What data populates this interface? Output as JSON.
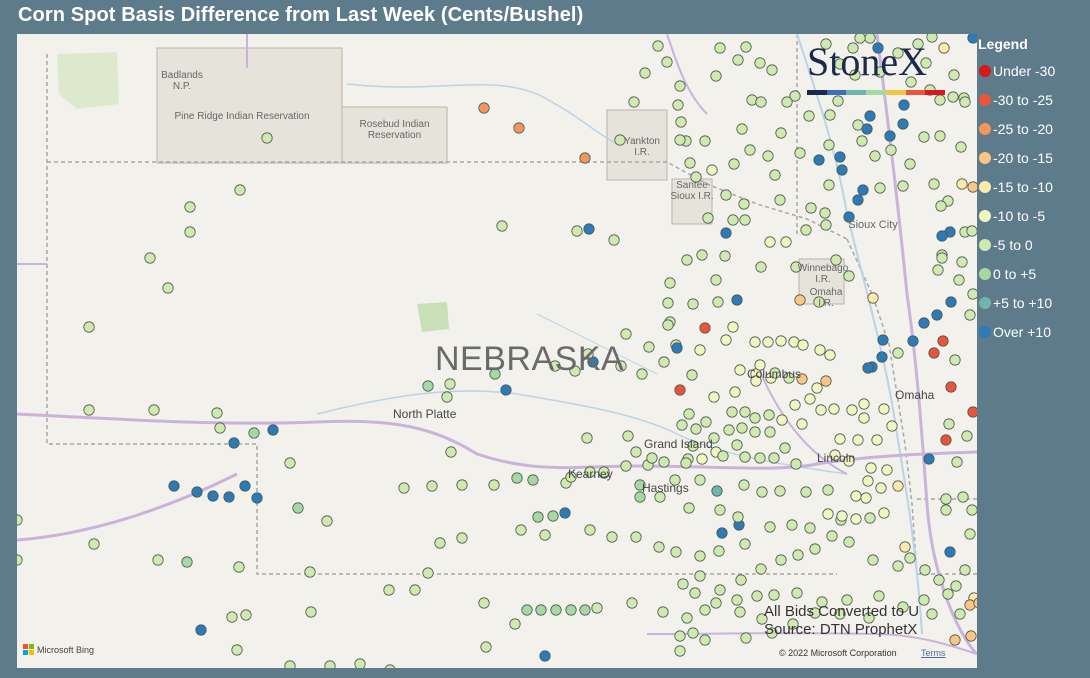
{
  "title": "Corn Spot Basis Difference from Last Week (Cents/Bushel)",
  "legend": {
    "title": "Legend",
    "items": [
      {
        "label": "Under -30",
        "color": "#d7191c"
      },
      {
        "label": "-30 to -25",
        "color": "#e8553a"
      },
      {
        "label": "-25 to -20",
        "color": "#f4955c"
      },
      {
        "label": "-20 to -15",
        "color": "#fbc583"
      },
      {
        "label": "-15 to -10",
        "color": "#fde9ab"
      },
      {
        "label": "-10 to -5",
        "color": "#f1f6c0"
      },
      {
        "label": "-5 to 0",
        "color": "#cfe9ae"
      },
      {
        "label": "0 to +5",
        "color": "#a6d9a2"
      },
      {
        "label": "+5 to +10",
        "color": "#6fb5ae"
      },
      {
        "label": "Over +10",
        "color": "#2c7bb6"
      }
    ]
  },
  "map": {
    "state_label": "NEBRASKA",
    "places": [
      "Badlands N.P.",
      "Pine Ridge Indian Reservation",
      "Rosebud Indian Reservation",
      "Yankton I.R.",
      "Santee Sioux I.R.",
      "Sioux City",
      "Winnebago I.R.",
      "Omaha I.R.",
      "Columbus",
      "Omaha",
      "North Platte",
      "Grand Island",
      "Kearney",
      "Hastings",
      "Lincoln"
    ],
    "attribution": {
      "provider": "Microsoft Bing",
      "copyright": "© 2022 Microsoft Corporation",
      "terms": "Terms"
    }
  },
  "logo": {
    "text": "StoneX",
    "colors": [
      "#1b2a4a",
      "#3b6fb6",
      "#6fb5ae",
      "#a6d9a2",
      "#f4c542",
      "#e8553a",
      "#d7191c"
    ]
  },
  "notes": {
    "line1": "All Bids Converted to U",
    "line2": "Source: DTN ProphetX"
  },
  "points": [
    [
      267,
      138,
      6
    ],
    [
      240,
      190,
      6
    ],
    [
      190,
      207,
      6
    ],
    [
      190,
      232,
      6
    ],
    [
      150,
      258,
      6
    ],
    [
      168,
      288,
      6
    ],
    [
      89,
      327,
      6
    ],
    [
      484,
      108,
      2
    ],
    [
      519,
      128,
      2
    ],
    [
      585,
      158,
      2
    ],
    [
      620,
      140,
      6
    ],
    [
      502,
      226,
      6
    ],
    [
      577,
      231,
      6
    ],
    [
      589,
      229,
      9
    ],
    [
      614,
      240,
      6
    ],
    [
      89,
      410,
      6
    ],
    [
      154,
      410,
      6
    ],
    [
      217,
      413,
      6
    ],
    [
      220,
      428,
      6
    ],
    [
      234,
      443,
      9
    ],
    [
      254,
      433,
      7
    ],
    [
      273,
      430,
      9
    ],
    [
      290,
      463,
      6
    ],
    [
      174,
      486,
      9
    ],
    [
      197,
      492,
      9
    ],
    [
      213,
      496,
      9
    ],
    [
      229,
      497,
      9
    ],
    [
      245,
      486,
      9
    ],
    [
      257,
      498,
      9
    ],
    [
      298,
      508,
      7
    ],
    [
      327,
      521,
      6
    ],
    [
      404,
      488,
      6
    ],
    [
      432,
      486,
      6
    ],
    [
      462,
      485,
      6
    ],
    [
      494,
      485,
      6
    ],
    [
      517,
      478,
      7
    ],
    [
      533,
      480,
      7
    ],
    [
      566,
      483,
      6
    ],
    [
      571,
      477,
      6
    ],
    [
      590,
      472,
      6
    ],
    [
      604,
      473,
      8
    ],
    [
      640,
      485,
      7
    ],
    [
      640,
      497,
      7
    ],
    [
      660,
      497,
      6
    ],
    [
      675,
      480,
      6
    ],
    [
      700,
      480,
      6
    ],
    [
      717,
      491,
      8
    ],
    [
      744,
      485,
      6
    ],
    [
      762,
      492,
      6
    ],
    [
      780,
      491,
      6
    ],
    [
      806,
      492,
      6
    ],
    [
      828,
      490,
      6
    ],
    [
      94,
      544,
      6
    ],
    [
      158,
      560,
      6
    ],
    [
      187,
      562,
      7
    ],
    [
      239,
      567,
      6
    ],
    [
      310,
      572,
      6
    ],
    [
      428,
      573,
      6
    ],
    [
      440,
      543,
      6
    ],
    [
      462,
      538,
      6
    ],
    [
      521,
      530,
      6
    ],
    [
      545,
      535,
      6
    ],
    [
      565,
      513,
      9
    ],
    [
      553,
      516,
      7
    ],
    [
      538,
      517,
      7
    ],
    [
      590,
      530,
      6
    ],
    [
      612,
      537,
      6
    ],
    [
      636,
      537,
      6
    ],
    [
      659,
      547,
      6
    ],
    [
      676,
      552,
      6
    ],
    [
      700,
      556,
      6
    ],
    [
      722,
      533,
      9
    ],
    [
      739,
      525,
      9
    ],
    [
      770,
      527,
      6
    ],
    [
      792,
      525,
      6
    ],
    [
      810,
      528,
      6
    ],
    [
      841,
      520,
      6
    ],
    [
      870,
      518,
      6
    ],
    [
      905,
      547,
      4
    ],
    [
      950,
      552,
      9
    ],
    [
      389,
      590,
      6
    ],
    [
      415,
      590,
      6
    ],
    [
      484,
      603,
      6
    ],
    [
      527,
      610,
      7
    ],
    [
      541,
      610,
      7
    ],
    [
      556,
      610,
      7
    ],
    [
      571,
      610,
      7
    ],
    [
      585,
      610,
      7
    ],
    [
      597,
      608,
      6
    ],
    [
      632,
      603,
      6
    ],
    [
      663,
      612,
      6
    ],
    [
      687,
      618,
      6
    ],
    [
      716,
      603,
      6
    ],
    [
      740,
      612,
      6
    ],
    [
      762,
      619,
      6
    ],
    [
      793,
      624,
      6
    ],
    [
      815,
      613,
      6
    ],
    [
      840,
      614,
      6
    ],
    [
      869,
      618,
      6
    ],
    [
      903,
      607,
      6
    ],
    [
      932,
      614,
      6
    ],
    [
      960,
      614,
      6
    ],
    [
      201,
      630,
      9
    ],
    [
      232,
      617,
      6
    ],
    [
      246,
      615,
      6
    ],
    [
      311,
      612,
      6
    ],
    [
      515,
      624,
      6
    ],
    [
      545,
      656,
      9
    ],
    [
      486,
      647,
      6
    ],
    [
      680,
      651,
      6
    ],
    [
      667,
      62,
      6
    ],
    [
      680,
      86,
      6
    ],
    [
      678,
      105,
      6
    ],
    [
      681,
      122,
      6
    ],
    [
      686,
      141,
      6
    ],
    [
      705,
      141,
      6
    ],
    [
      690,
      163,
      6
    ],
    [
      696,
      177,
      6
    ],
    [
      712,
      170,
      5
    ],
    [
      726,
      195,
      6
    ],
    [
      744,
      204,
      6
    ],
    [
      745,
      220,
      6
    ],
    [
      733,
      220,
      6
    ],
    [
      726,
      233,
      9
    ],
    [
      725,
      256,
      6
    ],
    [
      761,
      267,
      6
    ],
    [
      770,
      242,
      5
    ],
    [
      786,
      242,
      5
    ],
    [
      796,
      267,
      6
    ],
    [
      800,
      300,
      3
    ],
    [
      819,
      302,
      6
    ],
    [
      873,
      298,
      4
    ],
    [
      849,
      276,
      6
    ],
    [
      836,
      260,
      6
    ],
    [
      806,
      230,
      6
    ],
    [
      826,
      225,
      6
    ],
    [
      825,
      213,
      6
    ],
    [
      811,
      208,
      6
    ],
    [
      780,
      200,
      6
    ],
    [
      775,
      175,
      6
    ],
    [
      768,
      156,
      6
    ],
    [
      750,
      150,
      6
    ],
    [
      734,
      164,
      6
    ],
    [
      742,
      129,
      6
    ],
    [
      781,
      133,
      6
    ],
    [
      800,
      153,
      6
    ],
    [
      830,
      115,
      6
    ],
    [
      858,
      125,
      6
    ],
    [
      862,
      141,
      6
    ],
    [
      875,
      156,
      6
    ],
    [
      891,
      150,
      6
    ],
    [
      910,
      164,
      6
    ],
    [
      934,
      184,
      6
    ],
    [
      948,
      201,
      6
    ],
    [
      941,
      206,
      6
    ],
    [
      903,
      186,
      6
    ],
    [
      880,
      188,
      6
    ],
    [
      863,
      190,
      9
    ],
    [
      849,
      217,
      9
    ],
    [
      858,
      200,
      9
    ],
    [
      842,
      170,
      9
    ],
    [
      840,
      157,
      9
    ],
    [
      829,
      185,
      6
    ],
    [
      819,
      160,
      9
    ],
    [
      829,
      145,
      6
    ],
    [
      867,
      129,
      9
    ],
    [
      870,
      116,
      9
    ],
    [
      890,
      136,
      9
    ],
    [
      903,
      124,
      9
    ],
    [
      924,
      137,
      6
    ],
    [
      940,
      136,
      6
    ],
    [
      904,
      105,
      9
    ],
    [
      911,
      82,
      6
    ],
    [
      930,
      90,
      6
    ],
    [
      940,
      100,
      6
    ],
    [
      953,
      97,
      6
    ],
    [
      964,
      98,
      6
    ],
    [
      880,
      72,
      6
    ],
    [
      870,
      38,
      6
    ],
    [
      855,
      75,
      6
    ],
    [
      838,
      101,
      6
    ],
    [
      809,
      116,
      6
    ],
    [
      795,
      96,
      6
    ],
    [
      772,
      70,
      6
    ],
    [
      752,
      100,
      6
    ],
    [
      761,
      102,
      6
    ],
    [
      738,
      60,
      6
    ],
    [
      716,
      76,
      6
    ],
    [
      658,
      46,
      6
    ],
    [
      645,
      73,
      6
    ],
    [
      634,
      102,
      6
    ],
    [
      680,
      140,
      6
    ],
    [
      720,
      48,
      6
    ],
    [
      746,
      47,
      6
    ],
    [
      760,
      63,
      6
    ],
    [
      787,
      102,
      6
    ],
    [
      840,
      64,
      6
    ],
    [
      826,
      44,
      6
    ],
    [
      853,
      48,
      6
    ],
    [
      973,
      38,
      9
    ],
    [
      944,
      48,
      4
    ],
    [
      954,
      75,
      6
    ],
    [
      926,
      63,
      6
    ],
    [
      918,
      44,
      6
    ],
    [
      932,
      37,
      6
    ],
    [
      898,
      53,
      6
    ],
    [
      878,
      48,
      9
    ],
    [
      860,
      38,
      6
    ],
    [
      965,
      102,
      6
    ],
    [
      961,
      147,
      6
    ],
    [
      962,
      184,
      4
    ],
    [
      973,
      187,
      3
    ],
    [
      950,
      232,
      9
    ],
    [
      942,
      236,
      9
    ],
    [
      965,
      232,
      6
    ],
    [
      972,
      231,
      6
    ],
    [
      938,
      270,
      6
    ],
    [
      942,
      255,
      6
    ],
    [
      942,
      258,
      6
    ],
    [
      962,
      262,
      6
    ],
    [
      973,
      294,
      6
    ],
    [
      959,
      280,
      6
    ],
    [
      970,
      315,
      6
    ],
    [
      951,
      302,
      9
    ],
    [
      937,
      315,
      9
    ],
    [
      924,
      323,
      9
    ],
    [
      913,
      341,
      9
    ],
    [
      898,
      353,
      6
    ],
    [
      883,
      340,
      9
    ],
    [
      882,
      357,
      9
    ],
    [
      872,
      367,
      9
    ],
    [
      868,
      368,
      9
    ],
    [
      934,
      353,
      1
    ],
    [
      943,
      341,
      1
    ],
    [
      955,
      360,
      6
    ],
    [
      951,
      387,
      1
    ],
    [
      973,
      412,
      1
    ],
    [
      967,
      436,
      6
    ],
    [
      946,
      440,
      1
    ],
    [
      949,
      424,
      6
    ],
    [
      929,
      459,
      9
    ],
    [
      957,
      462,
      6
    ],
    [
      946,
      499,
      6
    ],
    [
      668,
      303,
      6
    ],
    [
      670,
      322,
      6
    ],
    [
      670,
      283,
      6
    ],
    [
      693,
      304,
      6
    ],
    [
      718,
      302,
      6
    ],
    [
      737,
      300,
      9
    ],
    [
      716,
      280,
      6
    ],
    [
      702,
      255,
      6
    ],
    [
      708,
      218,
      6
    ],
    [
      687,
      260,
      6
    ],
    [
      668,
      325,
      6
    ],
    [
      705,
      328,
      1
    ],
    [
      676,
      345,
      6
    ],
    [
      677,
      348,
      9
    ],
    [
      680,
      390,
      1
    ],
    [
      692,
      375,
      6
    ],
    [
      700,
      350,
      5
    ],
    [
      726,
      340,
      5
    ],
    [
      733,
      327,
      5
    ],
    [
      755,
      342,
      5
    ],
    [
      768,
      342,
      5
    ],
    [
      781,
      341,
      5
    ],
    [
      794,
      342,
      5
    ],
    [
      803,
      345,
      5
    ],
    [
      820,
      350,
      5
    ],
    [
      830,
      355,
      5
    ],
    [
      756,
      374,
      5
    ],
    [
      771,
      378,
      5
    ],
    [
      756,
      381,
      5
    ],
    [
      740,
      370,
      5
    ],
    [
      760,
      365,
      5
    ],
    [
      775,
      373,
      6
    ],
    [
      789,
      378,
      6
    ],
    [
      802,
      379,
      3
    ],
    [
      826,
      381,
      3
    ],
    [
      817,
      388,
      5
    ],
    [
      821,
      410,
      5
    ],
    [
      834,
      409,
      5
    ],
    [
      852,
      410,
      5
    ],
    [
      864,
      404,
      5
    ],
    [
      864,
      418,
      5
    ],
    [
      884,
      409,
      5
    ],
    [
      892,
      426,
      5
    ],
    [
      877,
      440,
      5
    ],
    [
      858,
      440,
      5
    ],
    [
      840,
      439,
      5
    ],
    [
      835,
      455,
      5
    ],
    [
      849,
      461,
      5
    ],
    [
      871,
      468,
      5
    ],
    [
      887,
      470,
      5
    ],
    [
      868,
      481,
      5
    ],
    [
      898,
      486,
      4
    ],
    [
      881,
      488,
      5
    ],
    [
      856,
      496,
      5
    ],
    [
      828,
      514,
      5
    ],
    [
      842,
      516,
      5
    ],
    [
      856,
      519,
      5
    ],
    [
      884,
      513,
      5
    ],
    [
      866,
      498,
      5
    ],
    [
      802,
      424,
      5
    ],
    [
      810,
      399,
      5
    ],
    [
      795,
      405,
      5
    ],
    [
      782,
      420,
      5
    ],
    [
      769,
      415,
      6
    ],
    [
      755,
      418,
      6
    ],
    [
      745,
      412,
      6
    ],
    [
      732,
      412,
      6
    ],
    [
      729,
      430,
      6
    ],
    [
      742,
      428,
      6
    ],
    [
      755,
      432,
      6
    ],
    [
      770,
      432,
      6
    ],
    [
      785,
      448,
      6
    ],
    [
      796,
      464,
      6
    ],
    [
      774,
      458,
      6
    ],
    [
      760,
      458,
      6
    ],
    [
      745,
      457,
      6
    ],
    [
      737,
      445,
      6
    ],
    [
      716,
      452,
      5
    ],
    [
      702,
      459,
      5
    ],
    [
      688,
      459,
      6
    ],
    [
      686,
      463,
      6
    ],
    [
      664,
      462,
      6
    ],
    [
      648,
      465,
      6
    ],
    [
      735,
      392,
      5
    ],
    [
      714,
      397,
      5
    ],
    [
      706,
      422,
      6
    ],
    [
      689,
      414,
      6
    ],
    [
      626,
      334,
      6
    ],
    [
      649,
      347,
      6
    ],
    [
      664,
      362,
      6
    ],
    [
      642,
      374,
      6
    ],
    [
      621,
      366,
      6
    ],
    [
      593,
      362,
      9
    ],
    [
      588,
      354,
      6
    ],
    [
      575,
      371,
      6
    ],
    [
      555,
      366,
      6
    ],
    [
      506,
      390,
      9
    ],
    [
      495,
      374,
      7
    ],
    [
      428,
      386,
      7
    ],
    [
      450,
      384,
      6
    ],
    [
      447,
      397,
      6
    ],
    [
      451,
      452,
      6
    ],
    [
      587,
      438,
      6
    ],
    [
      604,
      472,
      6
    ],
    [
      628,
      436,
      6
    ],
    [
      636,
      452,
      6
    ],
    [
      652,
      458,
      6
    ],
    [
      682,
      425,
      6
    ],
    [
      696,
      429,
      6
    ],
    [
      714,
      438,
      6
    ],
    [
      723,
      456,
      6
    ],
    [
      693,
      446,
      6
    ],
    [
      626,
      466,
      6
    ],
    [
      689,
      508,
      6
    ],
    [
      720,
      510,
      6
    ],
    [
      738,
      517,
      6
    ],
    [
      745,
      544,
      6
    ],
    [
      719,
      551,
      6
    ],
    [
      700,
      576,
      6
    ],
    [
      683,
      584,
      6
    ],
    [
      695,
      593,
      6
    ],
    [
      680,
      636,
      6
    ],
    [
      693,
      633,
      6
    ],
    [
      705,
      640,
      6
    ],
    [
      746,
      638,
      6
    ],
    [
      772,
      633,
      6
    ],
    [
      946,
      510,
      6
    ],
    [
      963,
      497,
      6
    ],
    [
      972,
      510,
      6
    ],
    [
      970,
      534,
      6
    ],
    [
      956,
      586,
      6
    ],
    [
      965,
      570,
      6
    ],
    [
      939,
      580,
      6
    ],
    [
      925,
      570,
      6
    ],
    [
      910,
      558,
      6
    ],
    [
      898,
      566,
      6
    ],
    [
      873,
      560,
      6
    ],
    [
      849,
      542,
      6
    ],
    [
      832,
      536,
      6
    ],
    [
      815,
      549,
      6
    ],
    [
      798,
      555,
      6
    ],
    [
      781,
      560,
      6
    ],
    [
      761,
      569,
      6
    ],
    [
      741,
      580,
      6
    ],
    [
      720,
      590,
      6
    ],
    [
      705,
      610,
      6
    ],
    [
      737,
      600,
      6
    ],
    [
      757,
      596,
      6
    ],
    [
      774,
      595,
      6
    ],
    [
      797,
      593,
      6
    ],
    [
      822,
      602,
      6
    ],
    [
      847,
      600,
      6
    ],
    [
      879,
      596,
      6
    ],
    [
      924,
      600,
      6
    ],
    [
      948,
      594,
      6
    ],
    [
      974,
      598,
      4
    ],
    [
      970,
      605,
      3
    ],
    [
      955,
      640,
      3
    ],
    [
      971,
      636,
      3
    ],
    [
      979,
      603,
      3
    ],
    [
      17,
      520,
      6
    ],
    [
      17,
      560,
      6
    ],
    [
      237,
      650,
      6
    ],
    [
      290,
      666,
      6
    ],
    [
      330,
      666,
      6
    ],
    [
      360,
      664,
      6
    ],
    [
      390,
      670,
      6
    ]
  ]
}
